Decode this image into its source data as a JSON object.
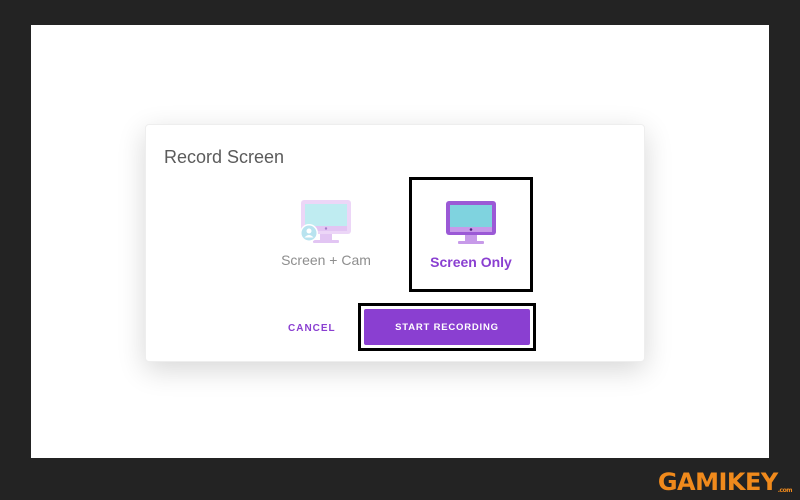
{
  "dialog": {
    "title": "Record Screen",
    "options": [
      {
        "label": "Screen + Cam",
        "icon": "monitor-with-avatar-icon",
        "selected": false
      },
      {
        "label": "Screen Only",
        "icon": "monitor-icon",
        "selected": true
      }
    ],
    "cancel_label": "CANCEL",
    "start_label": "START RECORDING"
  },
  "watermark": {
    "text": "GAMIKEY",
    "suffix": ".com"
  },
  "colors": {
    "accent": "#8a3fd1",
    "screen_fill": "#7fd3df",
    "monitor_light": "#d9b3f0",
    "monitor_dark": "#9b59d6",
    "background_frame": "#232323",
    "watermark": "#f08a1c"
  }
}
